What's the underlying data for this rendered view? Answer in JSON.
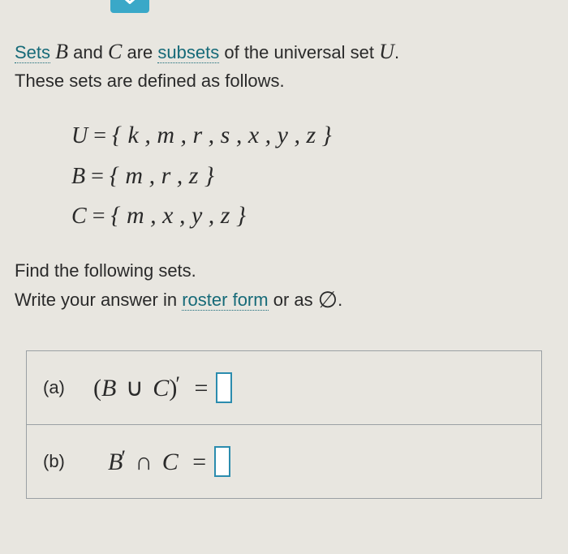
{
  "intro": {
    "word_sets": "Sets",
    "var_b": "B",
    "word_and": "and",
    "var_c": "C",
    "word_are": "are",
    "word_subsets": "subsets",
    "rest1": "of the universal set",
    "var_u": "U",
    "period": ".",
    "line2": "These sets are defined as follows."
  },
  "sets": {
    "u": {
      "lhs": "U",
      "rhs": "{ k , m , r , s , x , y , z }"
    },
    "b": {
      "lhs": "B",
      "rhs": "{ m , r , z }"
    },
    "c": {
      "lhs": "C",
      "rhs": "{ m , x , y , z }"
    }
  },
  "instr": {
    "line1": "Find the following sets.",
    "line2a": "Write your answer in",
    "roster": "roster form",
    "line2b": "or as",
    "empty": "∅",
    "period": "."
  },
  "parts": {
    "a": {
      "label": "(a)",
      "lparen": "(",
      "b": "B",
      "op": "∪",
      "c": "C",
      "rparen": ")",
      "prime": "′",
      "eq": "="
    },
    "b": {
      "label": "(b)",
      "b": "B",
      "prime": "′",
      "op": "∩",
      "c": "C",
      "eq": "="
    }
  }
}
